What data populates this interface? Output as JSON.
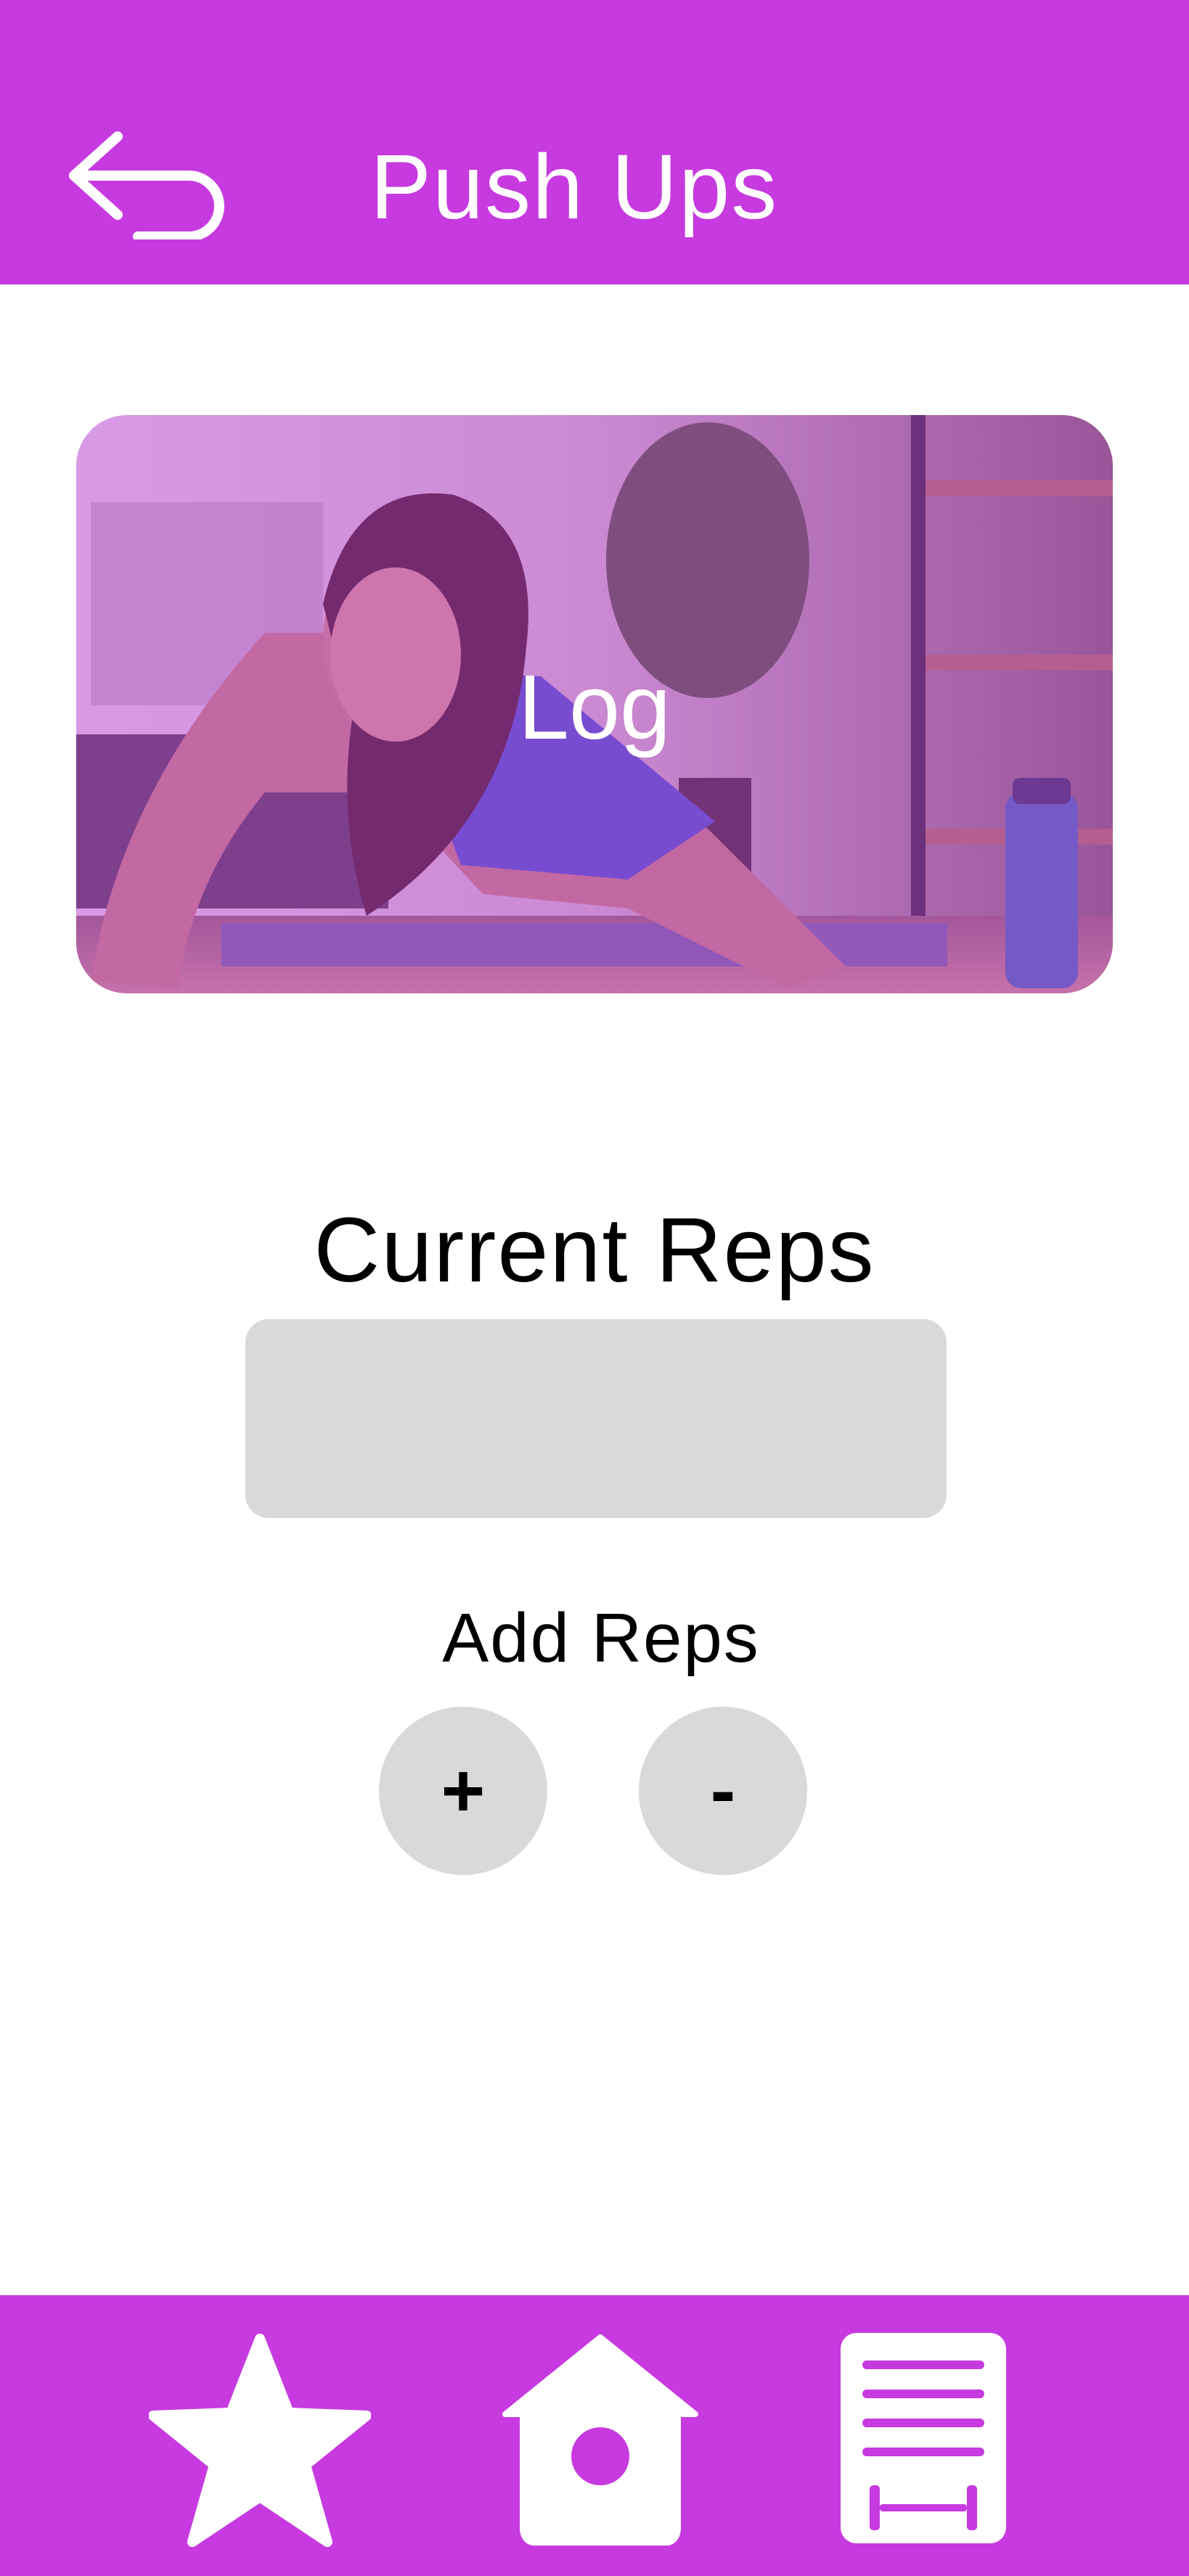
{
  "header": {
    "title": "Push Ups",
    "back_icon": "back-arrow-icon"
  },
  "hero": {
    "label": "Log",
    "overlay_color": "#c63ae0"
  },
  "reps": {
    "current_title": "Current Reps",
    "current_value": "",
    "add_title": "Add Reps",
    "plus_label": "+",
    "minus_label": "-"
  },
  "nav": {
    "items": [
      {
        "icon": "star-icon"
      },
      {
        "icon": "home-icon"
      },
      {
        "icon": "workout-log-icon"
      }
    ]
  },
  "colors": {
    "brand": "#c63ae0",
    "surface": "#d9d9d9",
    "text": "#000000",
    "on_brand": "#ffffff"
  }
}
